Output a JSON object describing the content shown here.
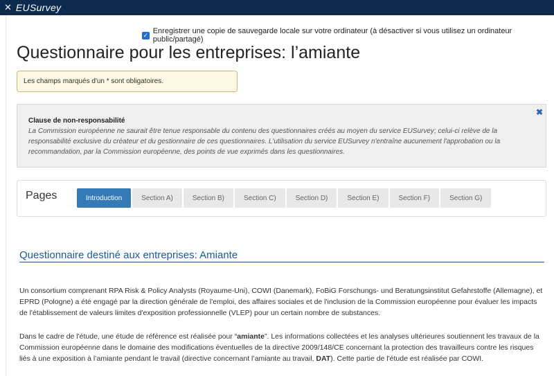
{
  "header": {
    "logo_icon": "star-icon",
    "logo_text": "EUSurvey"
  },
  "save_option": {
    "checked": true,
    "label": "Enregistrer une copie de sauvegarde locale sur votre ordinateur (à désactiver si vous utilisez un ordinateur public/partagé)"
  },
  "survey_title": "Questionnaire pour les entreprises: l’amiante",
  "required_note": "Les champs marqués d'un * sont obligatoires.",
  "disclaimer": {
    "title": "Clause de non-responsabilité",
    "text": "La Commission européenne ne saurait être tenue responsable du contenu des questionnaires créés au moyen du service EUSurvey; celui-ci relève de la responsabilité exclusive du créateur et du gestionnaire de ces questionnaires. L'utilisation du service EUSurvey n'entraîne aucunement l'approbation ou la recommandation, par la Commission européenne, des points de vue exprimés dans les questionnaires.",
    "close_icon": "close-icon"
  },
  "pages": {
    "label": "Pages",
    "tabs": [
      "Introduction",
      "Section A)",
      "Section B)",
      "Section C)",
      "Section D)",
      "Section E)",
      "Section F)",
      "Section G)"
    ],
    "active": "Introduction"
  },
  "section": {
    "title": "Questionnaire destiné aux entreprises: Amiante",
    "para1": "Un consortium comprenant RPA Risk & Policy Analysts (Royaume-Uni), COWI (Danemark), FoBiG Forschungs- und Beratungsinstitut Gefahrstoffe (Allemagne), et EPRD (Pologne) a été engagé par la direction générale de l'emploi, des affaires sociales et de l'inclusion de la Commission européenne pour évaluer les impacts de l'établissement de valeurs limites d'exposition professionnelle (VLEP) pour un certain nombre de substances.",
    "para2_a": "Dans le cadre de l'étude, une étude de référence est réalisée pour “",
    "para2_b": "amiante",
    "para2_c": "”. Les informations collectées et les analyses ultérieures soutiennent les travaux de la Commission européenne dans le domaine des modifications éventuelles de la directive 2009/148/CE concernant la protection des travailleurs contre les risques liés à une exposition à l’amiante pendant le travail (directive concernant l’amiante au travail, ",
    "para2_d": "DAT",
    "para2_e": "). Cette partie de l'étude est réalisée par COWI."
  }
}
